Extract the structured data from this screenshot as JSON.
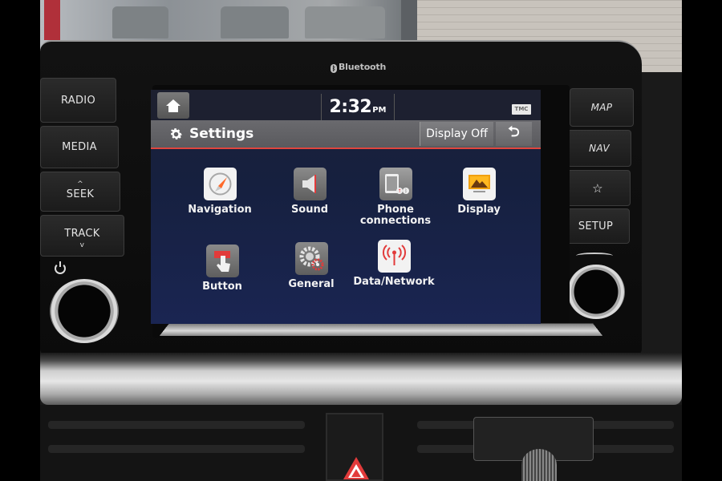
{
  "hardware": {
    "bezel_label": "Bluetooth",
    "left_buttons": [
      {
        "label": "RADIO",
        "arrow": ""
      },
      {
        "label": "MEDIA",
        "arrow": ""
      },
      {
        "label": "SEEK",
        "arrow": "^"
      },
      {
        "label": "TRACK",
        "arrow": "v"
      }
    ],
    "right_buttons": [
      {
        "label": "MAP"
      },
      {
        "label": "NAV"
      },
      {
        "label": "☆"
      },
      {
        "label": "SETUP"
      }
    ]
  },
  "screen": {
    "status": {
      "time": "2:32",
      "ampm": "PM",
      "badge": "TMC"
    },
    "header": {
      "title": "Settings",
      "display_off_label": "Display Off",
      "back_symbol": "⮌"
    },
    "menu": [
      {
        "label": "Navigation",
        "icon": "compass-icon"
      },
      {
        "label": "Sound",
        "icon": "speaker-icon"
      },
      {
        "label": "Phone connections",
        "label_line1": "Phone",
        "label_line2": "connections",
        "icon": "phone-bluetooth-icon"
      },
      {
        "label": "Display",
        "icon": "display-icon"
      },
      {
        "label": "Button",
        "icon": "button-press-icon"
      },
      {
        "label": "General",
        "icon": "gears-icon"
      },
      {
        "label": "Data/Network",
        "icon": "antenna-icon"
      }
    ],
    "colors": {
      "accent": "#e0453e",
      "background": "#16203f"
    }
  }
}
